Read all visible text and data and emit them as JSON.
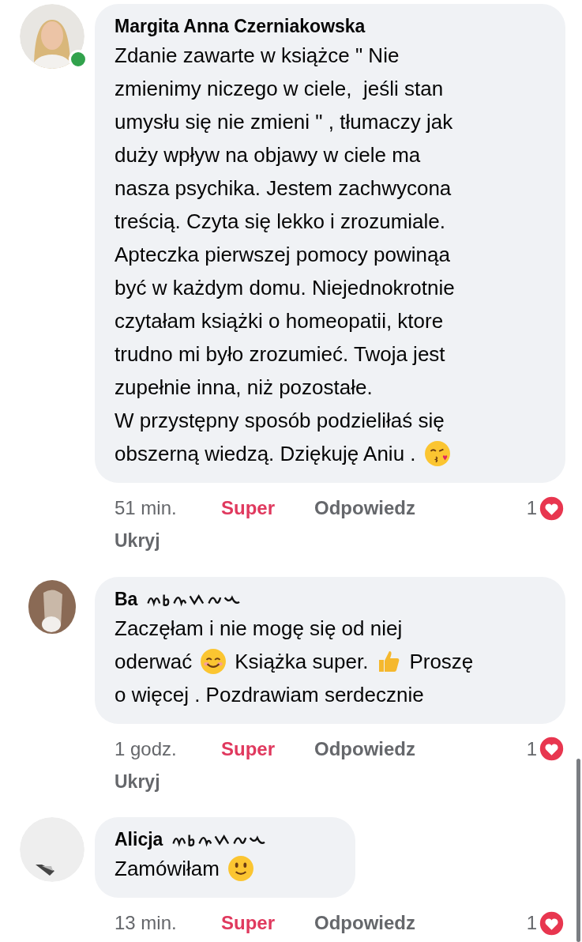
{
  "comments": [
    {
      "author": "Margita Anna Czerniakowska",
      "author_obscured": false,
      "online": true,
      "avatar": {
        "kind": "picture"
      },
      "lines": [
        [
          {
            "kind": "text",
            "text": "Zdanie zawarte w książce \" Nie"
          }
        ],
        [
          {
            "kind": "text",
            "text": "zmienimy niczego w ciele,  jeśli stan"
          }
        ],
        [
          {
            "kind": "text",
            "text": "umysłu się nie zmieni \" , tłumaczy jak"
          }
        ],
        [
          {
            "kind": "text",
            "text": "duży wpływ na objawy w ciele ma"
          }
        ],
        [
          {
            "kind": "text",
            "text": "nasza psychika. Jestem zachwycona"
          }
        ],
        [
          {
            "kind": "text",
            "text": "treścią. Czyta się lekko i zrozumiale."
          }
        ],
        [
          {
            "kind": "text",
            "text": "Apteczka pierwszej pomocy powinąa"
          }
        ],
        [
          {
            "kind": "text",
            "text": "być w każdym domu. Niejednokrotnie"
          }
        ],
        [
          {
            "kind": "text",
            "text": "czytałam książki o homeopatii, ktore"
          }
        ],
        [
          {
            "kind": "text",
            "text": "trudno mi było zrozumieć. Twoja jest"
          }
        ],
        [
          {
            "kind": "text",
            "text": "zupełnie inna, niż pozostałe."
          }
        ],
        [
          {
            "kind": "text",
            "text": "W przystępny sposób podzieliłaś się"
          }
        ],
        [
          {
            "kind": "text",
            "text": "obszerną wiedzą. Dziękuję Aniu ."
          },
          {
            "kind": "kiss"
          }
        ]
      ],
      "time": "51 min.",
      "react": "Super",
      "reacted": true,
      "reply": "Odpowiedz",
      "hide": "Ukryj",
      "count": "1"
    },
    {
      "author": "Ba",
      "author_obscured": true,
      "online": false,
      "avatar": {
        "kind": "picture"
      },
      "lines": [
        [
          {
            "kind": "text",
            "text": "Zaczęłam i nie mogę się od niej"
          }
        ],
        [
          {
            "kind": "text",
            "text": "oderwać"
          },
          {
            "kind": "smile"
          },
          {
            "kind": "text",
            "text": "Książka super."
          },
          {
            "kind": "thumbs"
          },
          {
            "kind": "text",
            "text": "Proszę"
          }
        ],
        [
          {
            "kind": "text",
            "text": "o więcej . Pozdrawiam serdecznie"
          }
        ]
      ],
      "time": "1 godz.",
      "react": "Super",
      "reacted": true,
      "reply": "Odpowiedz",
      "hide": "Ukryj",
      "count": "1"
    },
    {
      "author": "Alicja",
      "author_obscured": true,
      "online": false,
      "avatar": {
        "kind": "picture"
      },
      "lines": [
        [
          {
            "kind": "text",
            "text": "Zamówiłam"
          },
          {
            "kind": "slight-smile"
          }
        ]
      ],
      "time": "13 min.",
      "react": "Super",
      "reacted": true,
      "reply": "Odpowiedz",
      "count": "1"
    }
  ]
}
